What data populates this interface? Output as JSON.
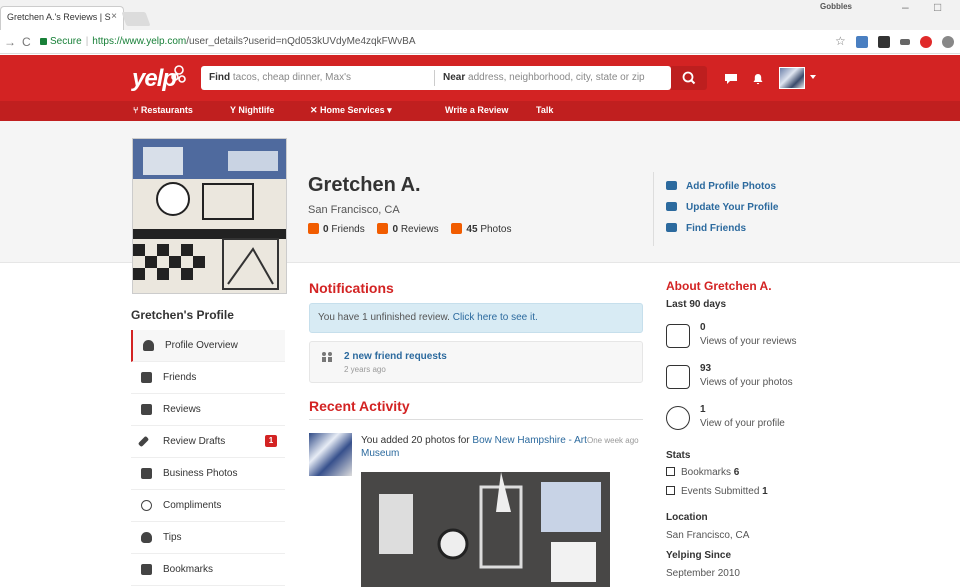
{
  "browser": {
    "tab_title": "Gretchen A.'s Reviews | S",
    "tab_close": "×",
    "profile_name": "Gobbles",
    "secure_label": "Secure",
    "url_host": "https://www.yelp.com",
    "url_path": "/user_details?userid=nQd053kUVdyMe4zqkFWvBA"
  },
  "header": {
    "logo": "yelp",
    "find_label": "Find",
    "find_placeholder": "tacos, cheap dinner, Max's",
    "near_label": "Near",
    "near_placeholder": "address, neighborhood, city, state or zip"
  },
  "nav": {
    "restaurants": "Restaurants",
    "nightlife": "Nightlife",
    "home_services": "Home Services ▾",
    "write_review": "Write a Review",
    "talk": "Talk"
  },
  "profile": {
    "name": "Gretchen A.",
    "location": "San Francisco, CA",
    "friends_count": "0",
    "friends_label": "Friends",
    "reviews_count": "0",
    "reviews_label": "Reviews",
    "photos_count": "45",
    "photos_label": "Photos"
  },
  "actions": {
    "add_photos": "Add Profile Photos",
    "update_profile": "Update Your Profile",
    "find_friends": "Find Friends"
  },
  "sidebar": {
    "title": "Gretchen's Profile",
    "items": [
      {
        "label": "Profile Overview",
        "icon": "person-icon"
      },
      {
        "label": "Friends",
        "icon": "friends-icon"
      },
      {
        "label": "Reviews",
        "icon": "star-icon"
      },
      {
        "label": "Review Drafts",
        "icon": "pencil-icon"
      },
      {
        "label": "Business Photos",
        "icon": "camera-icon"
      },
      {
        "label": "Compliments",
        "icon": "ribbon-icon"
      },
      {
        "label": "Tips",
        "icon": "bulb-icon"
      },
      {
        "label": "Bookmarks",
        "icon": "bookmark-icon"
      }
    ],
    "drafts_badge": "1"
  },
  "notifications": {
    "title": "Notifications",
    "unfinished_text": "You have 1 unfinished review.",
    "unfinished_link": "Click here to see it.",
    "friend_requests": "2 new friend requests",
    "friend_requests_time": "2 years ago"
  },
  "activity": {
    "title": "Recent Activity",
    "text": "You added 20 photos for",
    "link": "Bow New Hampshire - Art Museum",
    "time": "One week ago"
  },
  "about": {
    "title": "About Gretchen A.",
    "period": "Last 90 days",
    "review_views": "0",
    "review_views_label": "Views of your reviews",
    "photo_views": "93",
    "photo_views_label": "Views of your photos",
    "profile_views": "1",
    "profile_views_label": "View of your profile",
    "stats_title": "Stats",
    "bookmarks_label": "Bookmarks",
    "bookmarks_value": "6",
    "events_label": "Events Submitted",
    "events_value": "1",
    "location_title": "Location",
    "location_value": "San Francisco, CA",
    "since_title": "Yelping Since",
    "since_value": "September 2010"
  },
  "colors": {
    "brand_red": "#d32323",
    "link_blue": "#2c6a9e",
    "notice_bg": "#d8ebf4"
  }
}
